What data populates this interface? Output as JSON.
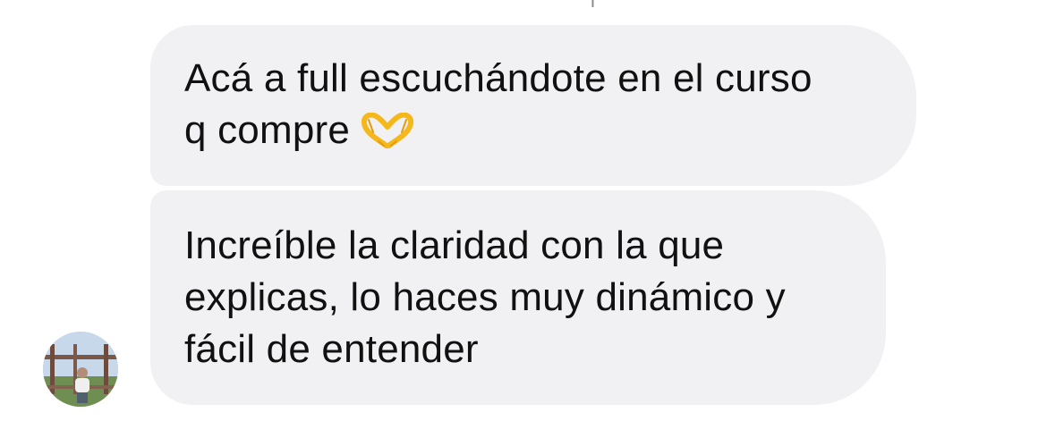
{
  "conversation": {
    "messages": [
      {
        "lines": [
          "Acá a full escuchándote en el curso",
          "q compre"
        ],
        "emoji": "heart-hands-emoji"
      },
      {
        "lines": [
          "Increíble la claridad con la que",
          "explicas, lo haces muy dinámico y",
          "fácil de entender"
        ]
      }
    ]
  },
  "colors": {
    "bubble_background": "#f1f1f3",
    "text": "#111111",
    "emoji": "#f5b81c"
  }
}
